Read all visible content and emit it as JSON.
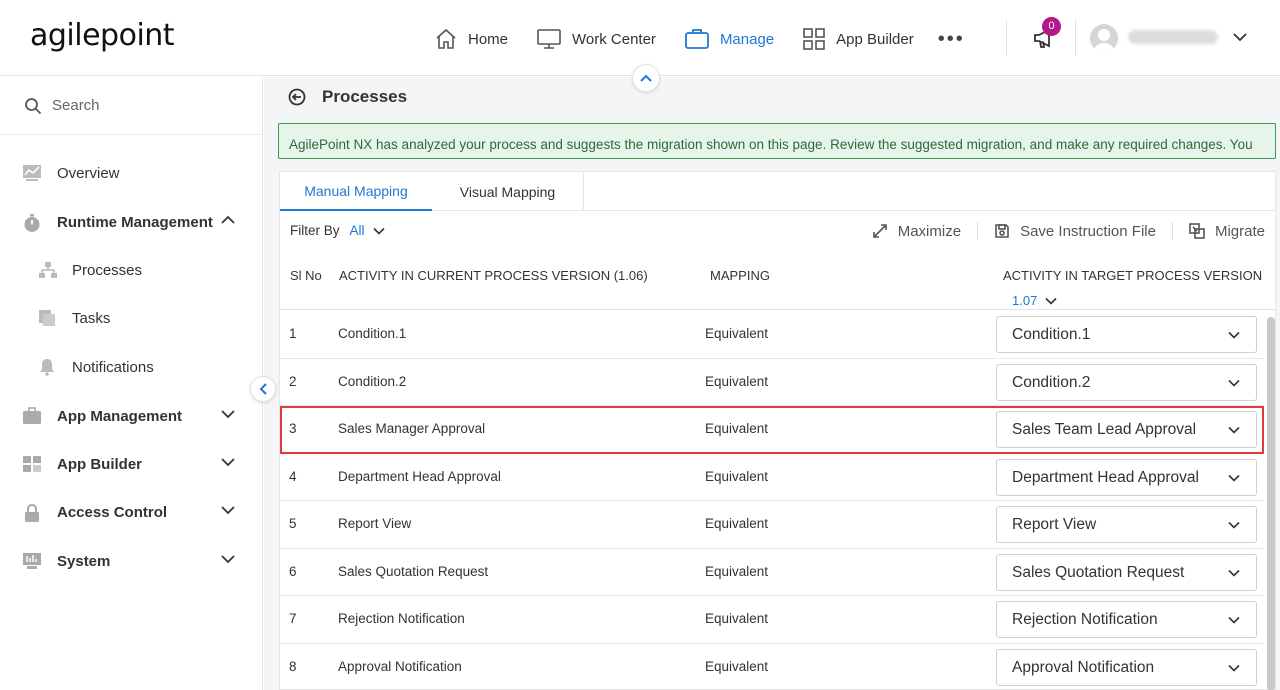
{
  "header": {
    "logo": "agilepoint",
    "nav": [
      {
        "label": "Home",
        "icon": "home-icon"
      },
      {
        "label": "Work Center",
        "icon": "monitor-icon"
      },
      {
        "label": "Manage",
        "icon": "briefcase-icon",
        "active": true
      },
      {
        "label": "App Builder",
        "icon": "grid-icon"
      }
    ],
    "more": "•••",
    "notification_count": "0",
    "accent": "#1e77d3",
    "badge_color": "#b5178c"
  },
  "sidebar": {
    "search_label": "Search",
    "items": [
      {
        "label": "Overview",
        "icon": "chart-icon"
      },
      {
        "label": "Runtime Management",
        "icon": "stopwatch-icon",
        "expanded": true
      },
      {
        "label": "Processes",
        "icon": "process-tree-icon"
      },
      {
        "label": "Tasks",
        "icon": "tasks-icon"
      },
      {
        "label": "Notifications",
        "icon": "bell-icon"
      },
      {
        "label": "App Management",
        "icon": "briefcase-icon"
      },
      {
        "label": "App Builder",
        "icon": "grid-icon"
      },
      {
        "label": "Access Control",
        "icon": "lock-icon"
      },
      {
        "label": "System",
        "icon": "system-icon"
      }
    ]
  },
  "main": {
    "title": "Processes",
    "alert": "AgilePoint NX has analyzed your process and suggests the migration shown on this page. Review the suggested migration, and make any required changes. You can change the target activity you want to map from the current process version.",
    "tabs": [
      "Manual Mapping",
      "Visual Mapping"
    ],
    "filter_label": "Filter By",
    "filter_value": "All",
    "tools": [
      "Maximize",
      "Save Instruction File",
      "Migrate"
    ],
    "columns": {
      "sl": "Sl No",
      "current": "ACTIVITY IN CURRENT PROCESS VERSION (1.06)",
      "mapping": "MAPPING",
      "target": "ACTIVITY IN TARGET PROCESS VERSION"
    },
    "target_version": "1.07",
    "rows": [
      {
        "sl": "1",
        "current": "Condition.1",
        "mapping": "Equivalent",
        "target": "Condition.1"
      },
      {
        "sl": "2",
        "current": "Condition.2",
        "mapping": "Equivalent",
        "target": "Condition.2"
      },
      {
        "sl": "3",
        "current": "Sales Manager Approval",
        "mapping": "Equivalent",
        "target": "Sales Team Lead Approval"
      },
      {
        "sl": "4",
        "current": "Department Head Approval",
        "mapping": "Equivalent",
        "target": "Department Head Approval"
      },
      {
        "sl": "5",
        "current": "Report View",
        "mapping": "Equivalent",
        "target": "Report View"
      },
      {
        "sl": "6",
        "current": "Sales Quotation Request",
        "mapping": "Equivalent",
        "target": "Sales Quotation Request"
      },
      {
        "sl": "7",
        "current": "Rejection Notification",
        "mapping": "Equivalent",
        "target": "Rejection Notification"
      },
      {
        "sl": "8",
        "current": "Approval Notification",
        "mapping": "Equivalent",
        "target": "Approval Notification"
      }
    ]
  }
}
